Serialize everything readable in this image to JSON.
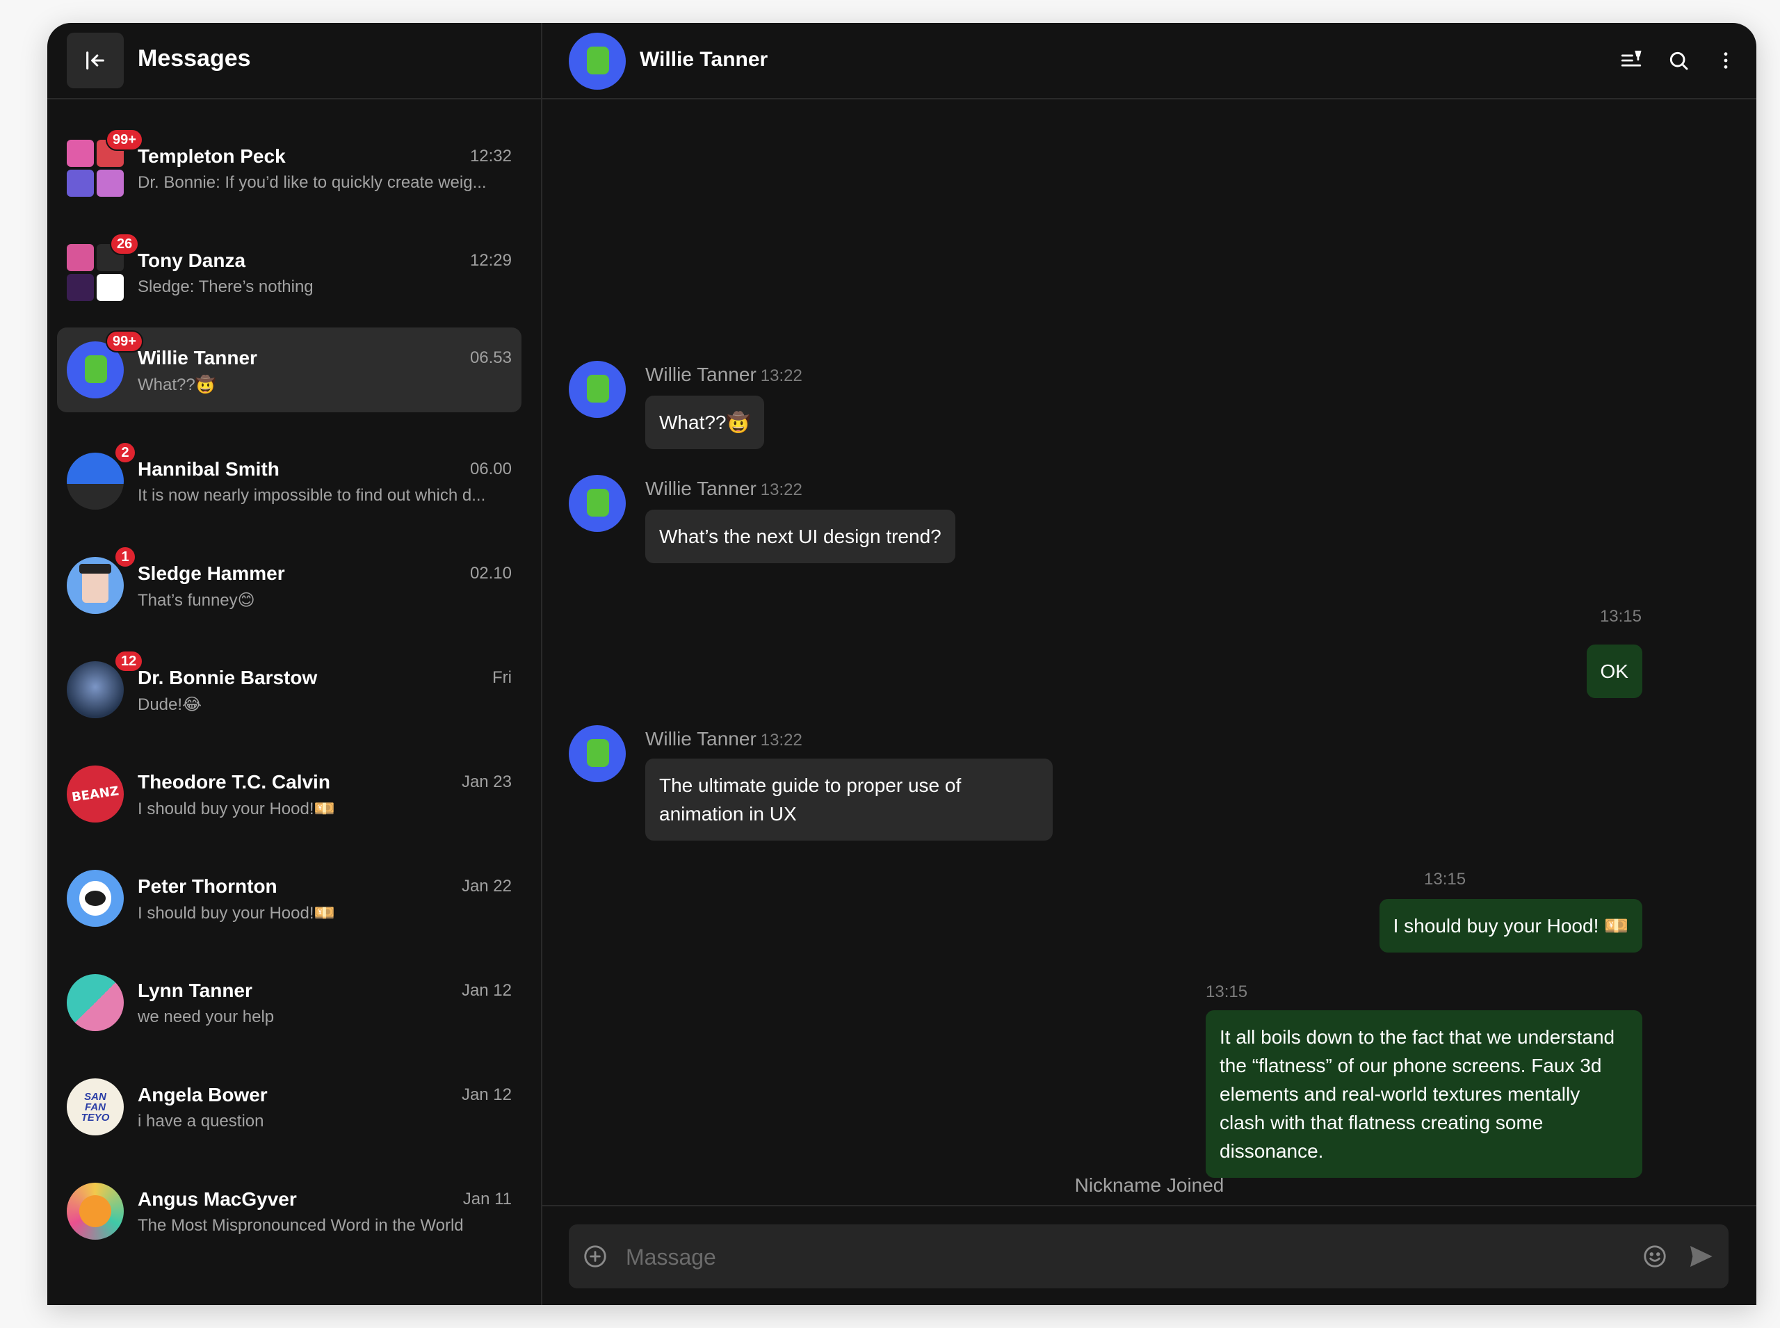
{
  "sidebar": {
    "title": "Messages",
    "conversations": [
      {
        "name": "Templeton Peck",
        "time": "12:32",
        "preview": "Dr. Bonnie: If you’d like to quickly create weig...",
        "badge": "99+"
      },
      {
        "name": "Tony Danza",
        "time": "12:29",
        "preview": "Sledge: There’s nothing",
        "badge": "26"
      },
      {
        "name": "Willie Tanner",
        "time": "06.53",
        "preview": "What??🤠",
        "badge": "99+"
      },
      {
        "name": "Hannibal Smith",
        "time": "06.00",
        "preview": "It is now nearly impossible to find out which d...",
        "badge": "2"
      },
      {
        "name": "Sledge Hammer",
        "time": "02.10",
        "preview": "That’s funney😊",
        "badge": "1"
      },
      {
        "name": "Dr. Bonnie Barstow",
        "time": "Fri",
        "preview": "Dude!😂",
        "badge": "12"
      },
      {
        "name": "Theodore T.C. Calvin",
        "time": "Jan 23",
        "preview": "I should buy your Hood!💴",
        "avatar_text": "BEANZ"
      },
      {
        "name": "Peter Thornton",
        "time": "Jan 22",
        "preview": "I should buy your Hood!💴"
      },
      {
        "name": "Lynn Tanner",
        "time": "Jan 12",
        "preview": "we need your help"
      },
      {
        "name": "Angela Bower",
        "time": "Jan 12",
        "preview": "i have a question",
        "avatar_text": "SAN FAN TEYO"
      },
      {
        "name": "Angus MacGyver",
        "time": "Jan 11",
        "preview": "The Most Mispronounced Word in the World"
      }
    ]
  },
  "chat": {
    "title": "Willie Tanner",
    "messages": [
      {
        "sender": "Willie Tanner",
        "time": "13:22",
        "text": "What??🤠"
      },
      {
        "sender": "Willie Tanner",
        "time": "13:22",
        "text": "What’s the next UI design trend?"
      },
      {
        "time": "13:15",
        "text": "OK"
      },
      {
        "sender": "Willie Tanner",
        "time": "13:22",
        "text": "The ultimate guide to proper use of animation in UX"
      },
      {
        "time": "13:15",
        "text": "I should buy your Hood! 💴"
      },
      {
        "time": "13:15",
        "text": "It all boils down to the fact that we understand the “flatness” of our phone screens. Faux 3d elements and real-world textures mentally clash with that flatness creating some dissonance."
      }
    ],
    "system_notice": "Nickname Joined",
    "composer_placeholder": "Massage"
  },
  "icons": {
    "back": "collapse-left-icon",
    "pinned": "pinned-list-icon",
    "search": "search-icon",
    "more": "more-vertical-icon",
    "attach": "plus-circle-icon",
    "emoji": "smiley-icon",
    "send": "send-icon"
  },
  "colors": {
    "background": "#131313",
    "outgoing_bubble": "#17401c",
    "incoming_bubble": "#2b2b2b",
    "badge": "#e0242f",
    "active_row": "#2d2d2d"
  }
}
